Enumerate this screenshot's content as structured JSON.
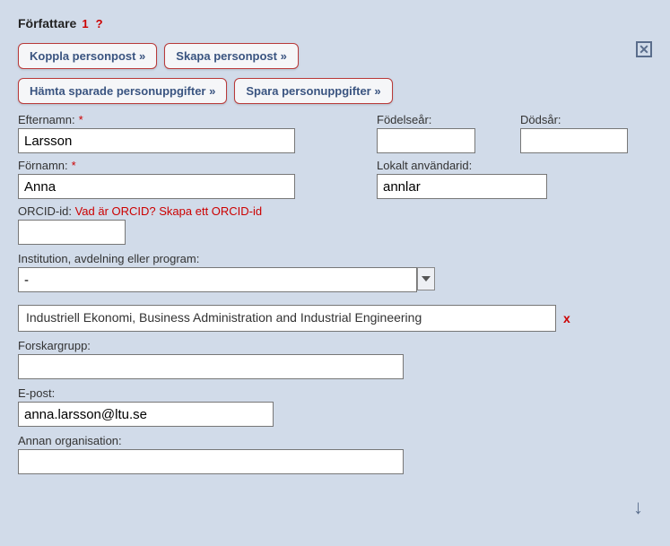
{
  "header": {
    "title": "Författare",
    "number": "1",
    "help": "?"
  },
  "buttons": {
    "link_person": "Koppla personpost »",
    "create_person": "Skapa personpost »",
    "fetch_saved": "Hämta sparade personuppgifter »",
    "save_person": "Spara personuppgifter »"
  },
  "labels": {
    "lastname": "Efternamn:",
    "firstname": "Förnamn:",
    "birthyear": "Födelseår:",
    "deathyear": "Dödsår:",
    "local_userid": "Lokalt användarid:",
    "orcid": "ORCID-id:",
    "orcid_link": "Vad är ORCID? Skapa ett ORCID-id",
    "institution": "Institution, avdelning eller program:",
    "research_group": "Forskargrupp:",
    "email": "E-post:",
    "other_org": "Annan organisation:",
    "required": "*"
  },
  "values": {
    "lastname": "Larsson",
    "firstname": "Anna",
    "birthyear": "",
    "deathyear": "",
    "local_userid": "annlar",
    "orcid": "",
    "institution_select": "-",
    "institution_chosen": "Industriell Ekonomi, Business Administration and Industrial Engineering",
    "research_group": "",
    "email": "anna.larsson@ltu.se",
    "other_org": ""
  },
  "icons": {
    "close": "✕",
    "remove": "x",
    "arrow_down": "↓"
  }
}
